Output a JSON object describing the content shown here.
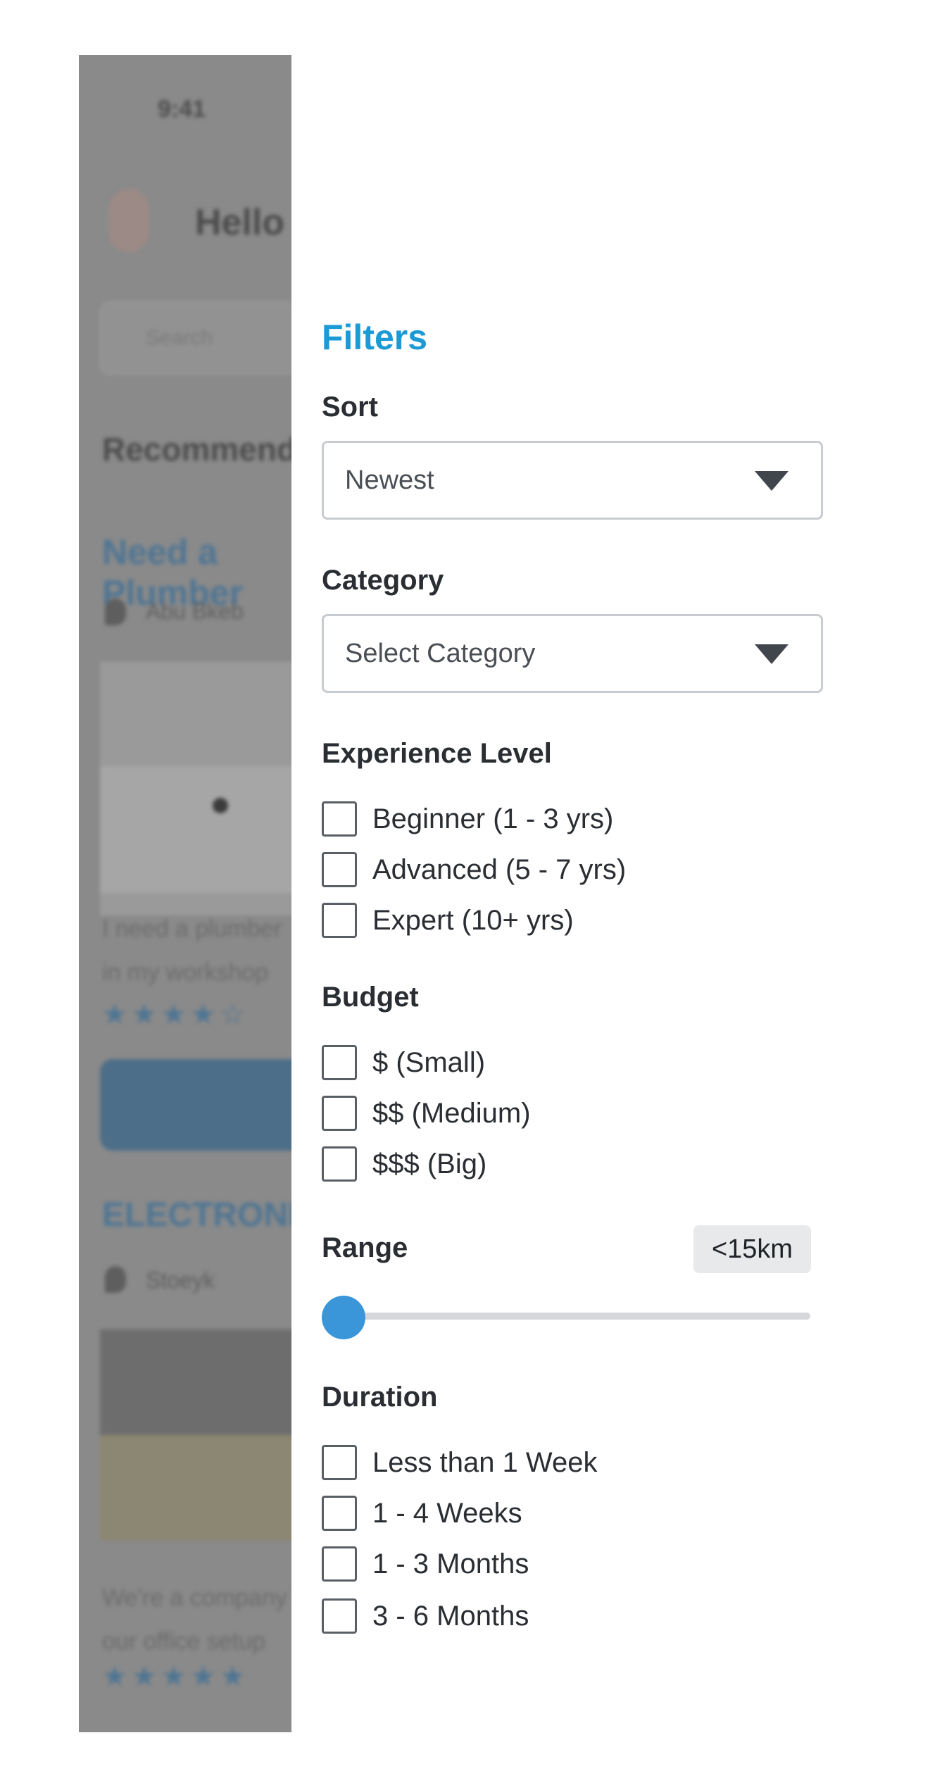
{
  "background_app": {
    "time": "9:41",
    "greeting": "Hello",
    "search_placeholder": "Search",
    "section_title": "Recommended",
    "card1": {
      "title": "Need a Plumber",
      "author": "Abu Bkeb",
      "description": "I need a plumber\nin my workshop",
      "stars": "★★★★☆"
    },
    "card2": {
      "title": "ELECTRONICS",
      "author": "Stoeyk",
      "description": "We're a company\nour office setup",
      "stars": "★★★★★"
    }
  },
  "filters": {
    "title": "Filters",
    "sort": {
      "label": "Sort",
      "selected": "Newest"
    },
    "category": {
      "label": "Category",
      "selected": "Select Category"
    },
    "experience": {
      "label": "Experience Level",
      "options": [
        {
          "label": "Beginner (1 - 3 yrs)",
          "checked": false
        },
        {
          "label": "Advanced (5 - 7 yrs)",
          "checked": false
        },
        {
          "label": "Expert (10+ yrs)",
          "checked": false
        }
      ]
    },
    "budget": {
      "label": "Budget",
      "options": [
        {
          "label": "$ (Small)",
          "checked": false
        },
        {
          "label": "$$ (Medium)",
          "checked": false
        },
        {
          "label": "$$$ (Big)",
          "checked": false
        }
      ]
    },
    "range": {
      "label": "Range",
      "value_label": "<15km",
      "slider_fraction": 0.0
    },
    "duration": {
      "label": "Duration",
      "options": [
        {
          "label": "Less than 1 Week",
          "checked": false
        },
        {
          "label": "1 - 4 Weeks",
          "checked": false
        },
        {
          "label": "1 - 3 Months",
          "checked": false
        },
        {
          "label": "3 - 6 Months",
          "checked": false
        }
      ]
    }
  },
  "colors": {
    "accent": "#1b9ad6",
    "slider": "#3b95d9",
    "overlay": "#8a8a8a"
  },
  "icons": {
    "dropdown": "caret-down-icon",
    "location": "location-pin-icon",
    "star": "star-icon"
  }
}
